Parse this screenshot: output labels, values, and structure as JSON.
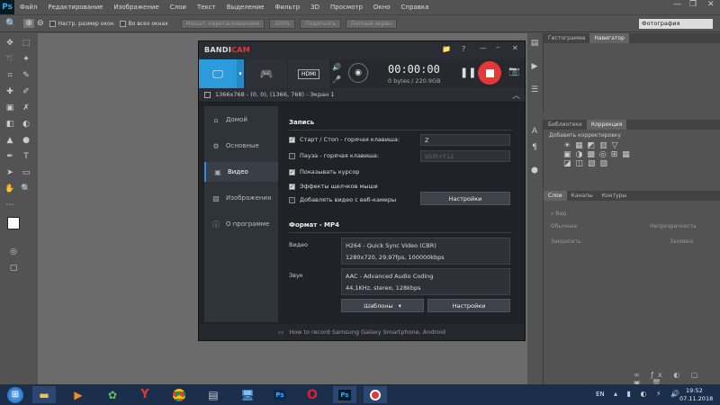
{
  "photoshop": {
    "logo": "Ps",
    "menu": [
      "Файл",
      "Редактирование",
      "Изображение",
      "Слои",
      "Текст",
      "Выделение",
      "Фильтр",
      "3D",
      "Просмотр",
      "Окно",
      "Справка"
    ],
    "options": {
      "sample_all_windows": "Настр. размер окон",
      "all_windows": "Во всех окнах",
      "zoom_percent": "100%",
      "fit_screen": "Подогнать",
      "scrubby": "Масшт. перетаскиванием",
      "full_screen": "Полный экран",
      "workspace": "Фотография"
    },
    "panels": {
      "histogram": "Гистограмма",
      "navigator": "Навигатор",
      "libraries": "Библиотеки",
      "adjustments": "Коррекция",
      "add_adjustment": "Добавить корректировку",
      "layers": "Слои",
      "channels": "Каналы",
      "paths": "Контуры",
      "search": "Вид",
      "blend_mode": "Обычные",
      "opacity": "Непрозрачность",
      "lock": "Закрепить:",
      "fill": "Заливка"
    }
  },
  "bandicam": {
    "logo_a": "BANDI",
    "logo_b": "CAM",
    "timer": "00:00:00",
    "bytes": "0 bytes / 220.9GB",
    "hdmi_label": "HDMI",
    "info": "1366x768 - (0, 0), (1366, 768) - Экран 1",
    "sidebar": [
      {
        "label": "Домой",
        "icon": "home-icon"
      },
      {
        "label": "Основные",
        "icon": "gear-icon"
      },
      {
        "label": "Видео",
        "icon": "video-icon"
      },
      {
        "label": "Изображения",
        "icon": "image-icon"
      },
      {
        "label": "О программе",
        "icon": "info-icon"
      }
    ],
    "record_section": "Запись",
    "start_stop": "Старт / Стоп - горячая клавиша:",
    "start_stop_key": "Z",
    "pause": "Пауза - горячая клавиша:",
    "pause_key": "Shift+F12",
    "show_cursor": "Показывать курсор",
    "click_effects": "Эффекты щелчков мыши",
    "webcam": "Добавлять видео с веб-камеры",
    "settings": "Настройки",
    "format_section": "Формат - MP4",
    "video_label": "Видео",
    "video_codec": "H264 - Quick Sync Video (CBR)",
    "video_params": "1280x720, 29,97fps, 100000kbps",
    "audio_label": "Звук",
    "audio_codec": "AAC - Advanced Audio Coding",
    "audio_params": "44,1KHz, stereo, 128kbps",
    "templates": "Шаблоны",
    "footer": "How to record Samsung Galaxy Smartphone, Android"
  },
  "taskbar": {
    "lang": "EN",
    "time": "19:52",
    "date": "07.11.2018"
  }
}
